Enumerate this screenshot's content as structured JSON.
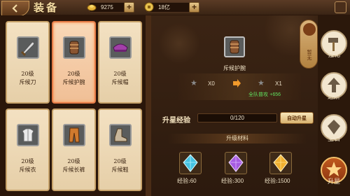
{
  "header": {
    "title": "装备",
    "gold": {
      "icon": "gold-ingot-icon",
      "value": "9275"
    },
    "silver": {
      "icon": "silver-coin-icon",
      "value": "18亿"
    }
  },
  "equipment": [
    {
      "level": "20级",
      "name": "斥候刀"
    },
    {
      "level": "20级",
      "name": "斥候护腕",
      "selected": true
    },
    {
      "level": "20级",
      "name": "斥候帽"
    },
    {
      "level": "20级",
      "name": "斥候衣"
    },
    {
      "level": "20级",
      "name": "斥候长裤"
    },
    {
      "level": "20级",
      "name": "斥候鞋"
    }
  ],
  "detail": {
    "item_name": "斥候护腕",
    "current_star": "X0",
    "next_star": "X1",
    "bonus_label": "全队普攻",
    "bonus_value": "+656",
    "xp_label": "升星经验",
    "xp_text": "0/120",
    "xp_progress": 0,
    "auto_button": "自动升星",
    "materials_title": "升级材料",
    "materials": [
      {
        "label": "经验:",
        "value": "60",
        "color": "#48c9e6"
      },
      {
        "label": "经验:",
        "value": "300",
        "color": "#a65be0"
      },
      {
        "label": "经验:",
        "value": "1500",
        "color": "#f0b030"
      }
    ],
    "scroll_badge": "暂无"
  },
  "side_tabs": [
    {
      "label": "强化",
      "icon": "hammer-icon"
    },
    {
      "label": "进阶",
      "icon": "arrow-up-icon"
    },
    {
      "label": "宝石",
      "icon": "gem-icon"
    },
    {
      "label": "升星",
      "icon": "star-icon",
      "active": true
    }
  ]
}
